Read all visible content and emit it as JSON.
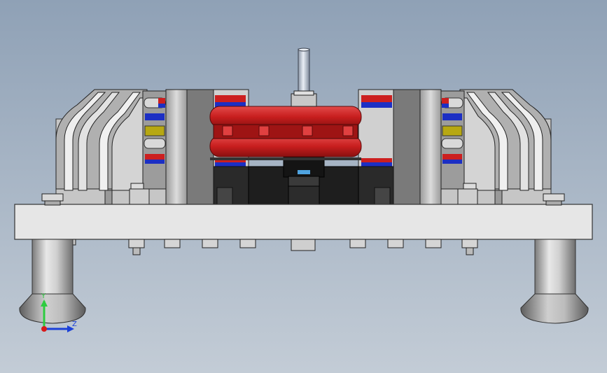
{
  "viewport": {
    "background_top": "#8fa1b6",
    "background_bottom": "#c3ccd6"
  },
  "triad": {
    "y_label": "Y",
    "z_label": "Z",
    "y_color": "#2ecc40",
    "z_color": "#1a40d8",
    "origin_color": "#d81a1a"
  },
  "colors": {
    "rotor": "#d32525",
    "magnet_blue": "#1c2fc4",
    "magnet_red": "#cc1f1f",
    "coil_yellow": "#b7a812",
    "frame_gray": "#bdbdbd",
    "base_plate": "#e6e6e6",
    "foot": "#b5b5b5"
  },
  "icons": [
    "coordinate-triad-icon"
  ]
}
